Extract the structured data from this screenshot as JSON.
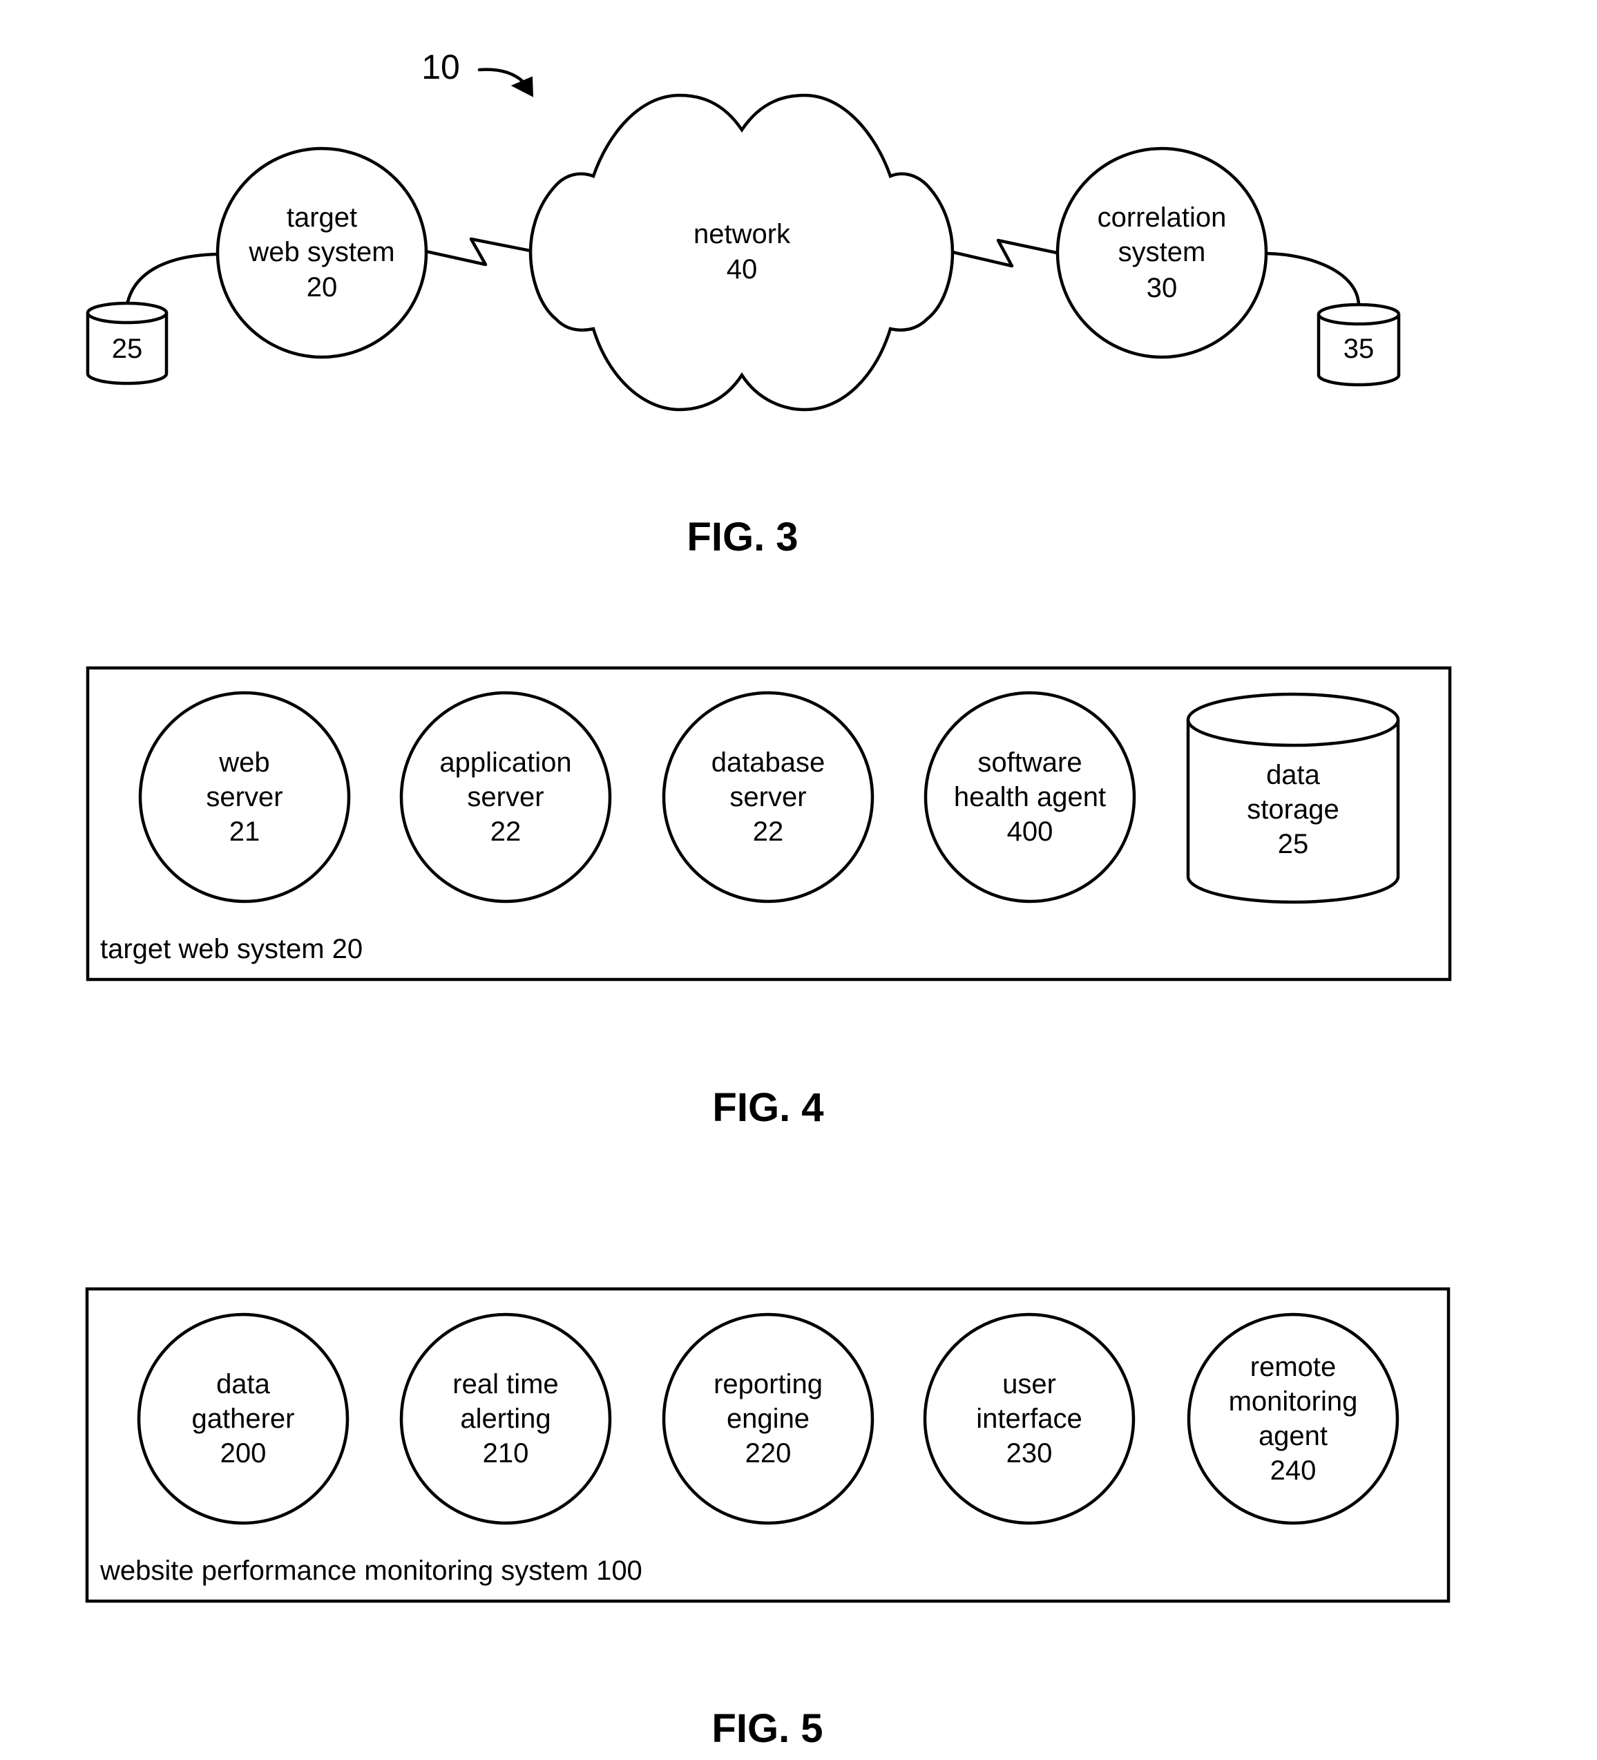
{
  "fig3": {
    "caption": "FIG. 3",
    "reference_numeral": "10",
    "target_web_system": {
      "lines": [
        "target",
        "web system",
        "20"
      ]
    },
    "network": {
      "lines": [
        "network",
        "40"
      ]
    },
    "correlation_system": {
      "lines": [
        "correlation",
        "system",
        "30"
      ]
    },
    "target_storage": {
      "label": "25"
    },
    "correlation_storage": {
      "label": "35"
    }
  },
  "fig4": {
    "caption": "FIG. 4",
    "container_label": "target web system 20",
    "components": [
      {
        "name": "web-server",
        "shape": "circle",
        "lines": [
          "web",
          "server",
          "21"
        ]
      },
      {
        "name": "application-server",
        "shape": "circle",
        "lines": [
          "application",
          "server",
          "22"
        ]
      },
      {
        "name": "database-server",
        "shape": "circle",
        "lines": [
          "database",
          "server",
          "22"
        ]
      },
      {
        "name": "software-health-agent",
        "shape": "circle",
        "lines": [
          "software",
          "health agent",
          "400"
        ]
      },
      {
        "name": "data-storage",
        "shape": "cylinder",
        "lines": [
          "data",
          "storage",
          "25"
        ]
      }
    ]
  },
  "fig5": {
    "caption": "FIG. 5",
    "container_label": "website performance monitoring system 100",
    "components": [
      {
        "name": "data-gatherer",
        "shape": "circle",
        "lines": [
          "data",
          "gatherer",
          "200"
        ]
      },
      {
        "name": "real-time-alerting",
        "shape": "circle",
        "lines": [
          "real time",
          "alerting",
          "210"
        ]
      },
      {
        "name": "reporting-engine",
        "shape": "circle",
        "lines": [
          "reporting",
          "engine",
          "220"
        ]
      },
      {
        "name": "user-interface",
        "shape": "circle",
        "lines": [
          "user",
          "interface",
          "230"
        ]
      },
      {
        "name": "remote-monitoring-agent",
        "shape": "circle",
        "lines": [
          "remote",
          "monitoring",
          "agent",
          "240"
        ]
      }
    ]
  }
}
